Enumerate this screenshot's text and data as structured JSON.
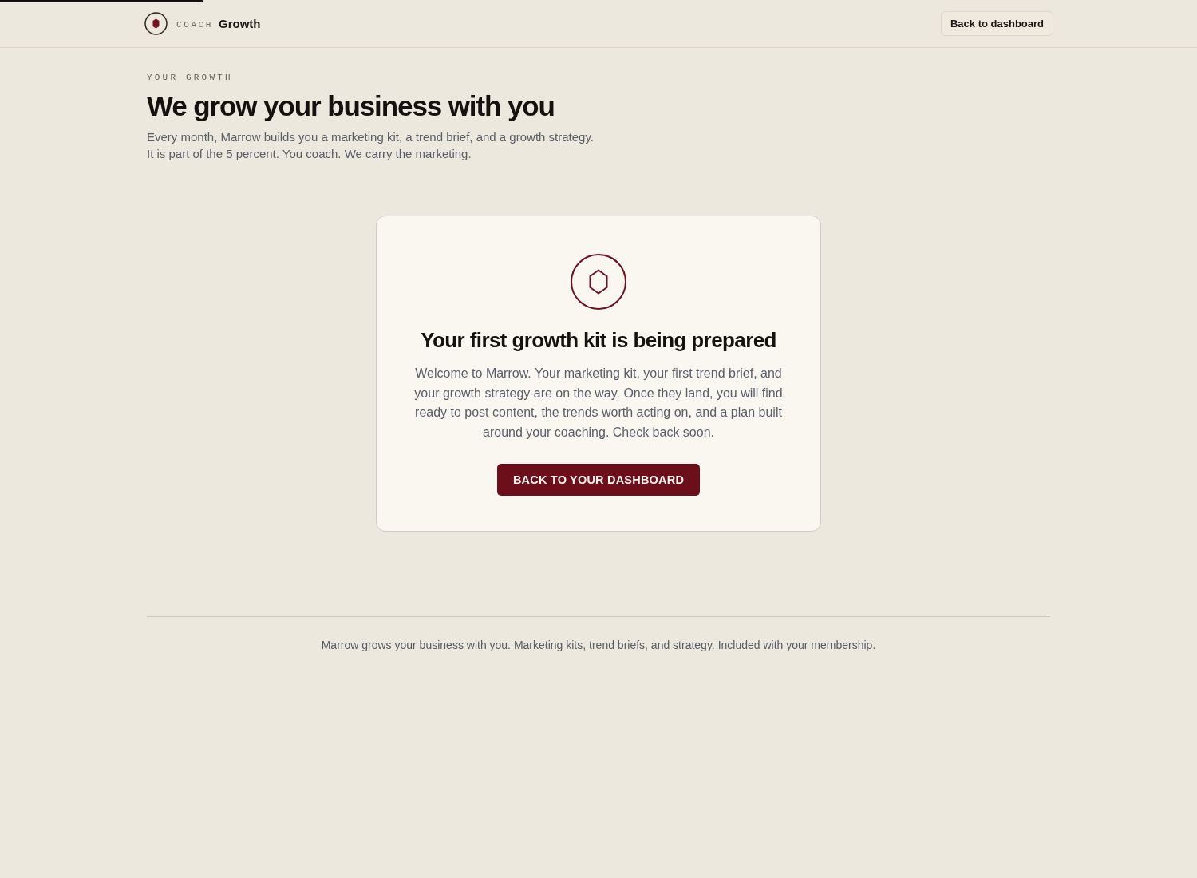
{
  "progress": {
    "level": 0.17
  },
  "header": {
    "brand": {
      "prefix": "COACH",
      "name": "Growth"
    },
    "button": "Back to dashboard"
  },
  "intro": {
    "eyebrow": "YOUR GROWTH",
    "title": "We grow your business with you",
    "lines": [
      "Every month, Marrow builds you a marketing kit, a trend brief, and a growth strategy.",
      "It is part of the 5 percent. You coach. We carry the marketing."
    ]
  },
  "card": {
    "title": "Your first growth kit is being prepared",
    "body": "Welcome to Marrow. Your marketing kit, your first trend brief, and your growth strategy are on the way. Once they land, you will find ready to post content, the trends worth acting on, and a plan built around your coaching. Check back soon.",
    "button": "BACK TO YOUR DASHBOARD"
  },
  "footer": {
    "text": "Marrow grows your business with you. Marketing kits, trend briefs, and strategy. Included with your membership."
  }
}
